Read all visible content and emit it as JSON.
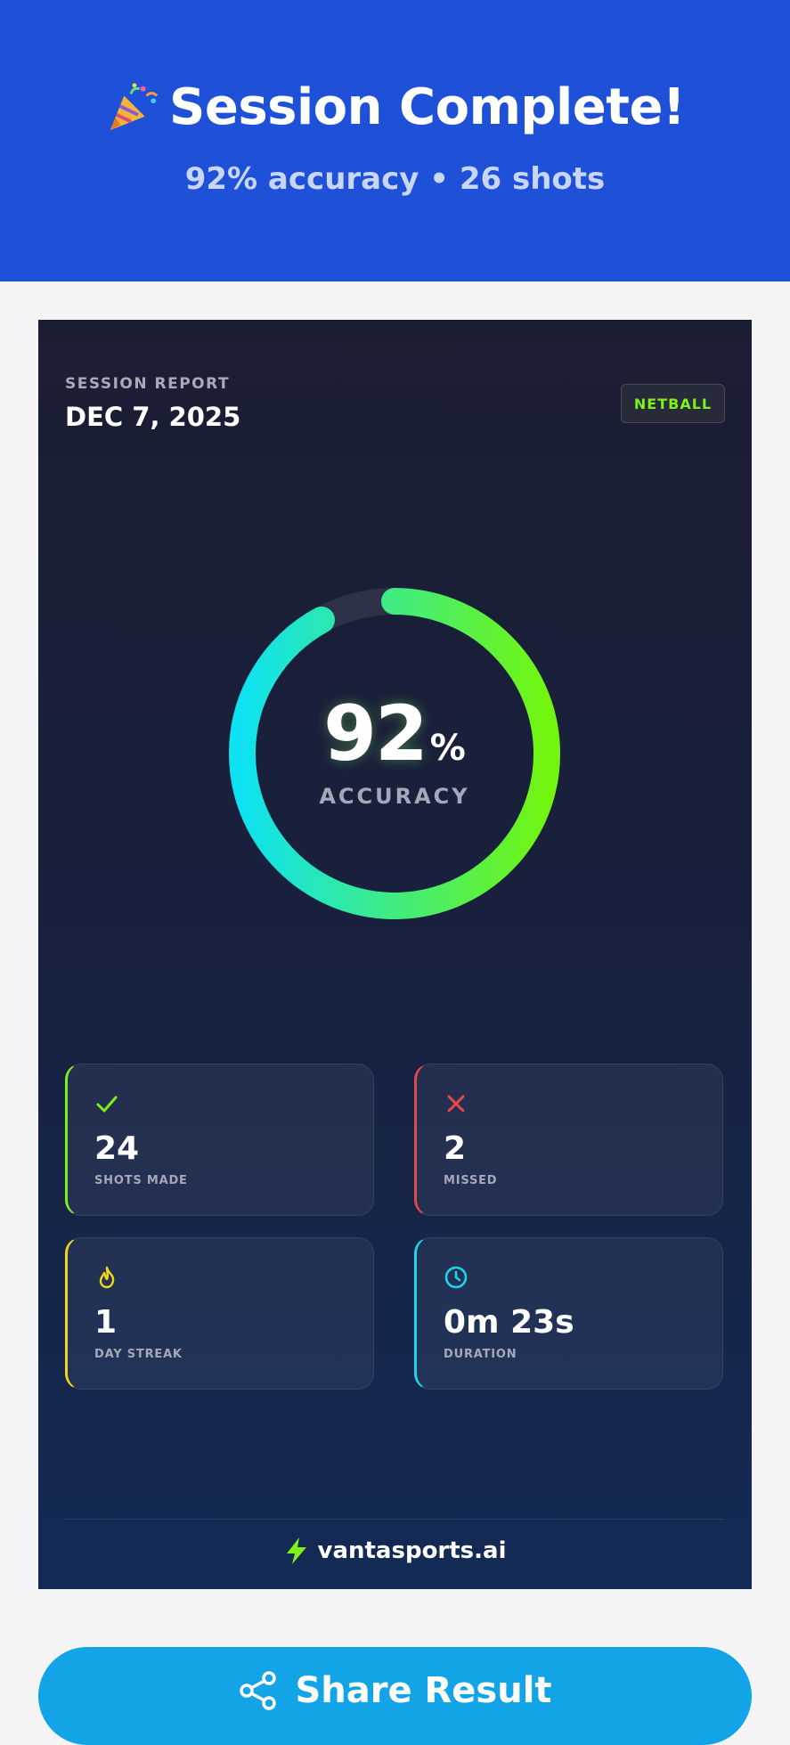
{
  "header": {
    "title": "Session Complete!",
    "party_icon": "party-popper-icon",
    "subtitle": "92% accuracy • 26 shots"
  },
  "card": {
    "report_label": "SESSION REPORT",
    "date": "DEC 7, 2025",
    "sport_badge": "NETBALL",
    "accuracy": {
      "value": "92",
      "unit": "%",
      "label": "ACCURACY",
      "fraction": 0.92
    },
    "stats": [
      {
        "icon": "check-icon",
        "value": "24",
        "label": "SHOTS MADE",
        "color": "#7ff018"
      },
      {
        "icon": "x-icon",
        "value": "2",
        "label": "MISSED",
        "color": "#e5474c"
      },
      {
        "icon": "flame-icon",
        "value": "1",
        "label": "DAY STREAK",
        "color": "#f2d61b"
      },
      {
        "icon": "clock-icon",
        "value": "0m 23s",
        "label": "DURATION",
        "color": "#1fd4ea"
      }
    ],
    "brand": "vantasports.ai",
    "brand_icon": "lightning-bolt-icon"
  },
  "share_button": {
    "label": "Share Result",
    "icon": "share-icon"
  },
  "colors": {
    "header_bg": "#1e50d8",
    "ring_start": "#0ee2f2",
    "ring_end": "#72f50e",
    "brand_accent": "#7ff018",
    "share_bg": "#12a4e6"
  }
}
